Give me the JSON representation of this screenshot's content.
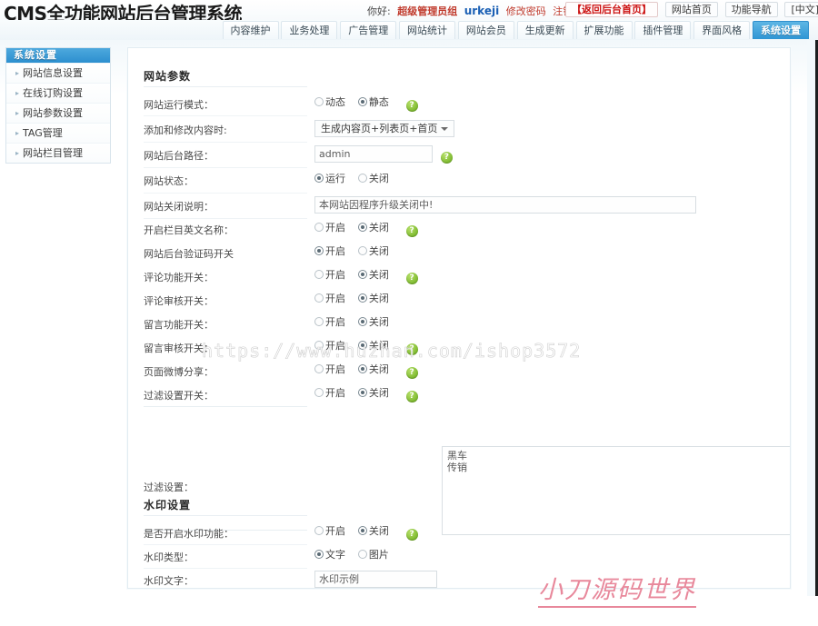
{
  "header": {
    "brand": "CMS全功能网站后台管理系统",
    "greeting_prefix": "你好:",
    "role": "超级管理员组",
    "username": "urkeji",
    "change_password": "修改密码",
    "logout": "注销登录",
    "arrow_left": "‹",
    "arrow_right": "›",
    "buttons": [
      {
        "label": "【返回后台首页】",
        "style": "red"
      },
      {
        "label": "网站首页",
        "style": "plain"
      },
      {
        "label": "功能导航",
        "style": "plain"
      },
      {
        "label": "[中文]切换",
        "style": "plain"
      }
    ]
  },
  "nav": {
    "tabs": [
      {
        "label": "内容维护",
        "active": false
      },
      {
        "label": "业务处理",
        "active": false
      },
      {
        "label": "广告管理",
        "active": false
      },
      {
        "label": "网站统计",
        "active": false
      },
      {
        "label": "网站会员",
        "active": false
      },
      {
        "label": "生成更新",
        "active": false
      },
      {
        "label": "扩展功能",
        "active": false
      },
      {
        "label": "插件管理",
        "active": false
      },
      {
        "label": "界面风格",
        "active": false
      },
      {
        "label": "系统设置",
        "active": true
      }
    ]
  },
  "sidebar": {
    "title": "系统设置",
    "arrow": "▸",
    "items": [
      {
        "label": "网站信息设置"
      },
      {
        "label": "在线订购设置"
      },
      {
        "label": "网站参数设置"
      },
      {
        "label": "TAG管理"
      },
      {
        "label": "网站栏目管理"
      }
    ]
  },
  "sections": {
    "site_params_title": "网站参数",
    "watermark_title": "水印设置"
  },
  "common": {
    "on": "开启",
    "off": "关闭",
    "help": "?"
  },
  "rows": {
    "run_mode": {
      "label": "网站运行模式：",
      "opt_a": "动态",
      "opt_b": "静态",
      "selected": "b",
      "help": true
    },
    "on_modify": {
      "label": "添加和修改内容时:",
      "value": "生成内容页+列表页+首页"
    },
    "admin_path": {
      "label": "网站后台路径：",
      "value": "admin",
      "help": true
    },
    "site_status": {
      "label": "网站状态：",
      "opt_a": "运行",
      "opt_b": "关闭",
      "selected": "a",
      "help": false
    },
    "close_note": {
      "label": "网站关闭说明：",
      "value": "本网站因程序升级关闭中!"
    },
    "en_colname": {
      "label": "开启栏目英文名称：",
      "selected": "b",
      "help": true
    },
    "admin_captcha": {
      "label": "网站后台验证码开关",
      "selected": "a",
      "help": false
    },
    "comment_fn": {
      "label": "评论功能开关：",
      "selected": "b",
      "help": true
    },
    "comment_audit": {
      "label": "评论审核开关：",
      "selected": "b",
      "help": false
    },
    "guestbook_fn": {
      "label": "留言功能开关：",
      "selected": "b",
      "help": false
    },
    "guestbook_audit": {
      "label": "留言审核开关：",
      "selected": "b",
      "help": true
    },
    "weibo_share": {
      "label": "页面微博分享：",
      "selected": "b",
      "help": true
    },
    "filter_switch": {
      "label": "过滤设置开关：",
      "selected": "b",
      "help": true
    },
    "filter_settings": {
      "label": "过滤设置：",
      "value": "黑车\n传销"
    },
    "wm_enable": {
      "label": "是否开启水印功能：",
      "selected": "b",
      "help": true
    },
    "wm_type": {
      "label": "水印类型：",
      "opt_a": "文字",
      "opt_b": "图片",
      "selected": "a",
      "help": false
    },
    "wm_text": {
      "label": "水印文字：",
      "value": "水印示例"
    }
  },
  "watermarks": {
    "url": "https://www.huzhan.com/ishop3572",
    "brand": "小刀源码世界"
  },
  "colors": {
    "accent": "#2f95d4",
    "red": "#cc1111",
    "help_green": "#63a814",
    "brand_pink": "#e8889b"
  }
}
